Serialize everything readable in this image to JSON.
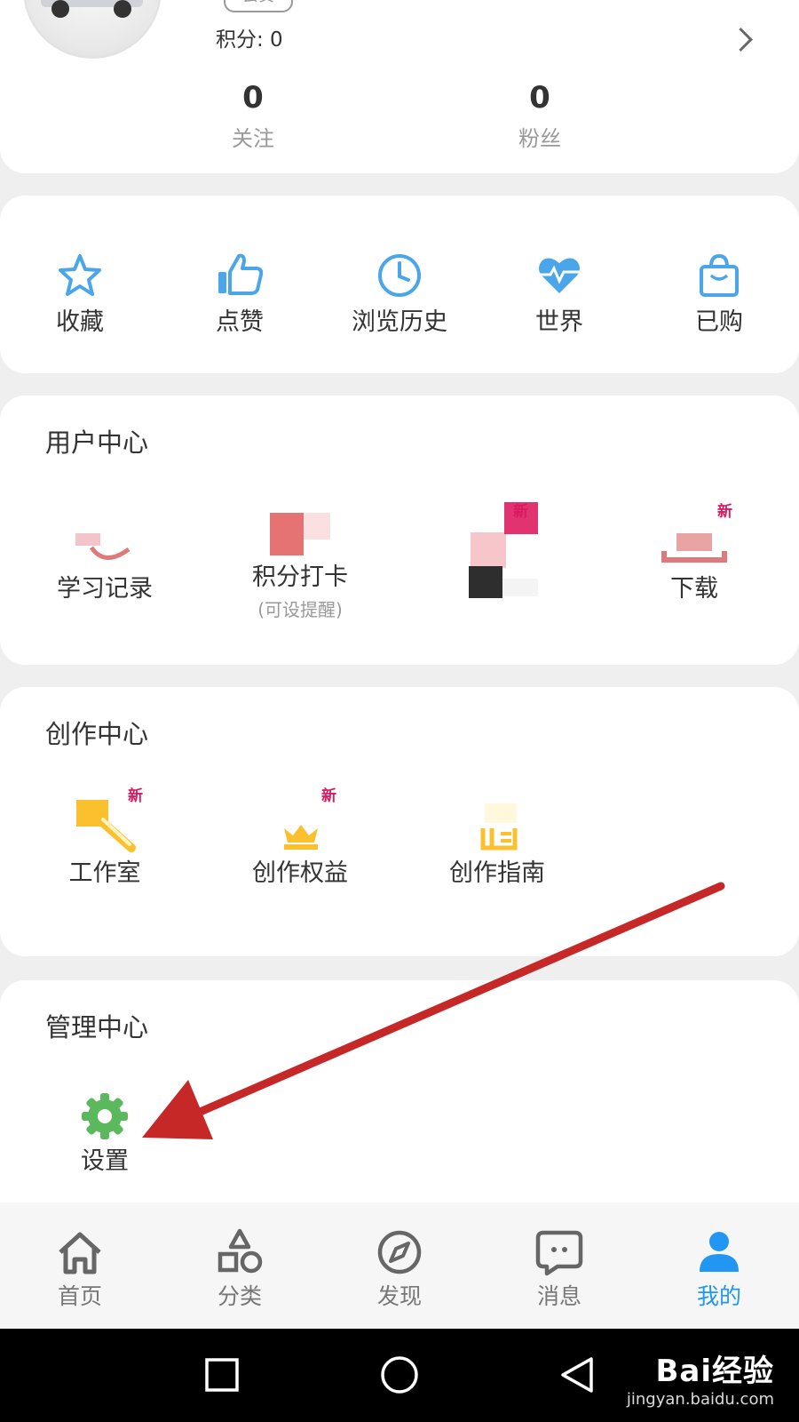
{
  "profile": {
    "member_tag": "会员",
    "points_label": "积分: 0",
    "following_count": "0",
    "following_label": "关注",
    "followers_count": "0",
    "followers_label": "粉丝"
  },
  "quick": {
    "favorites": "收藏",
    "likes": "点赞",
    "history": "浏览历史",
    "world": "世界",
    "purchased": "已购"
  },
  "user_center": {
    "title": "用户中心",
    "study_record": "学习记录",
    "checkin": "积分打卡",
    "checkin_sub": "(可设提醒)",
    "download": "下载",
    "new_badge": "新"
  },
  "create_center": {
    "title": "创作中心",
    "studio": "工作室",
    "rights": "创作权益",
    "guide": "创作指南",
    "new_badge": "新"
  },
  "manage_center": {
    "title": "管理中心",
    "settings": "设置"
  },
  "tabbar": {
    "home": "首页",
    "category": "分类",
    "discover": "发现",
    "messages": "消息",
    "mine": "我的"
  },
  "watermark": {
    "brand": "Bai经验",
    "url": "jingyan.baidu.com"
  },
  "colors": {
    "accent": "#2196f3",
    "icon_blue": "#4aa6e8",
    "settings_green": "#5cb85c",
    "arrow_red": "#c62828",
    "badge_pink": "#d81b60"
  }
}
